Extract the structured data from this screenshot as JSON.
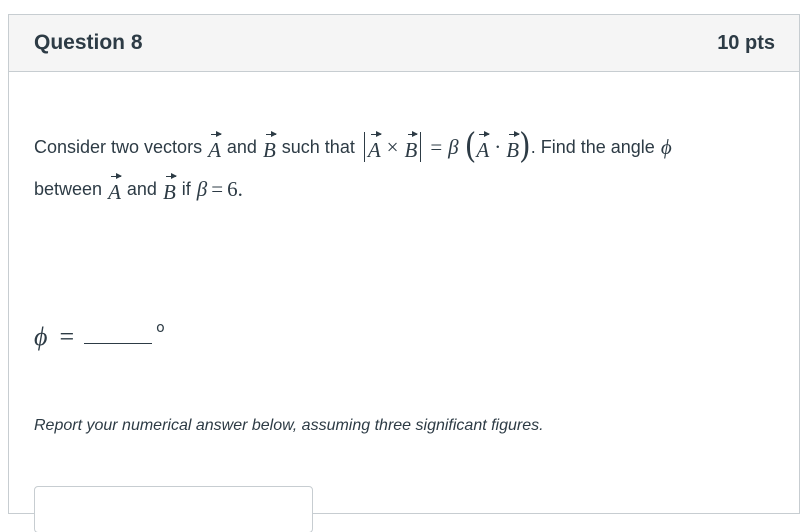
{
  "question": {
    "title": "Question 8",
    "points": "10 pts"
  },
  "prompt": {
    "text_consider": "Consider two vectors",
    "vec_a": "A",
    "text_and": "and",
    "vec_b": "B",
    "text_such_that": "such that",
    "times_sign": "×",
    "equals_sign": "=",
    "beta": "β",
    "left_paren": "(",
    "dot_sign": "·",
    "right_paren": ")",
    "text_find": ". Find the angle",
    "phi": "ϕ",
    "text_between": "between",
    "text_and_2": "and",
    "text_if": "if",
    "beta_2": "β",
    "equals_2": "=",
    "beta_value": "6",
    "period": "."
  },
  "answer_line": {
    "phi": "ϕ",
    "equals": "=",
    "degree": "o"
  },
  "instructions": "Report your numerical answer below, assuming three significant figures.",
  "answer_input": {
    "value": "",
    "placeholder": ""
  }
}
